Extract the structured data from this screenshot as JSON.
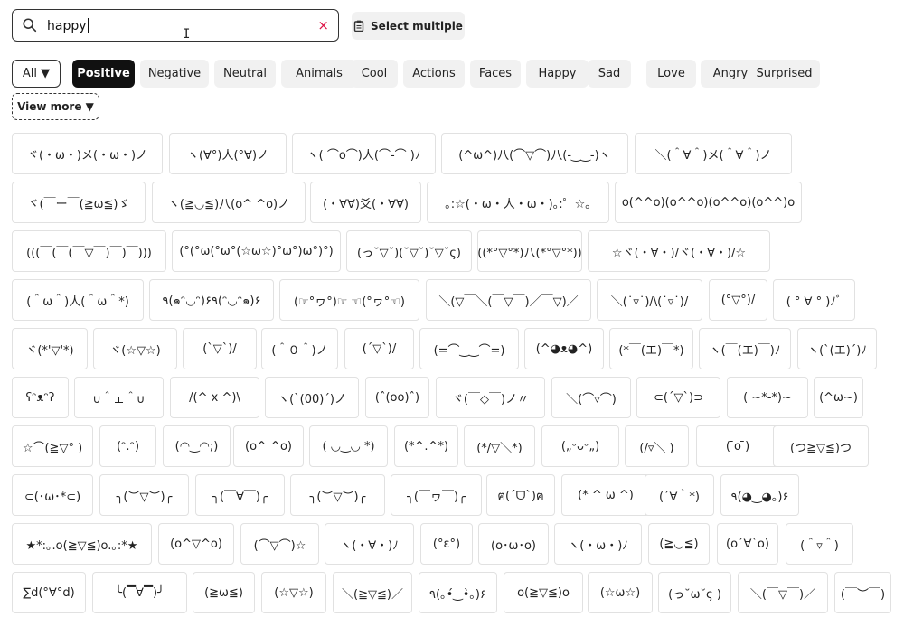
{
  "search": {
    "value": "happy",
    "clear": "×"
  },
  "toolbar": {
    "select_multiple": "Select multiple"
  },
  "filters": [
    {
      "label": "All ▼",
      "kind": "all"
    },
    {
      "label": "Positive",
      "kind": "active"
    },
    {
      "label": "Negative",
      "kind": ""
    },
    {
      "label": "Neutral",
      "kind": ""
    },
    {
      "label": "Animals",
      "kind": ""
    },
    {
      "label": "Cool",
      "kind": ""
    },
    {
      "label": "Actions",
      "kind": ""
    },
    {
      "label": "Faces",
      "kind": ""
    },
    {
      "label": "Happy",
      "kind": ""
    },
    {
      "label": "Sad",
      "kind": ""
    },
    {
      "label": "Love",
      "kind": ""
    },
    {
      "label": "Angry",
      "kind": ""
    },
    {
      "label": "Surprised",
      "kind": ""
    }
  ],
  "view_more": "View more ▼",
  "kaomoji_rows": [
    [
      "ヾ(・ω・)メ(・ω・)ノ",
      "ヽ(∀°)人(°∀)ノ",
      "ヽ( ⌒o⌒)人(⌒-⌒ )ﾉ",
      "(^ω^)八(⌒▽⌒)八(-‿‿-)ヽ",
      "＼(＾∀＾)メ(＾∀＾)ノ"
    ],
    [
      "ヾ(￣ー￣(≧ω≦)ゞ",
      "ヽ(≧◡≦)八(o^ ^o)ノ",
      "(・∀∀)爻(・∀∀)",
      "｡:☆(・ω・人・ω・)｡:゜☆｡",
      "o(^^o)(o^^o)(o^^o)(o^^)o"
    ],
    [
      "(((￣(￣(￣▽￣)￣)￣)))",
      "(°(°ω(°ω°(☆ω☆)°ω°)ω°)°)",
      "(っ˘▽˘)(˘▽˘)˘▽˘ς)",
      "(((*°▽°*)八(*°▽°*)))",
      "☆ヾ(・∀・)/ヾ(・∀・)/☆"
    ],
    [
      "(＾ω＾)人(＾ω＾*)",
      "٩(๑ᵔ◡ᵔ)۶٩(ᵔ◡ᵔ๑)۶",
      "(☞°ヮ°)☞ ☜(°ヮ°☜)",
      "＼(▽￣＼(￣▽￣)／￣▽)／",
      "＼(˙▿˙)/\\(˙▿˙)/",
      "(°▽°)/",
      "( ° ∀ ° )ﾉﾞ"
    ],
    [
      "ヾ(*'▽'*)",
      "ヾ(☆▽☆)",
      "(ˋ▽ˋ)/",
      "(＾０＾)ノ",
      "(´▽`)/",
      "(=⌒‿‿⌒=)",
      "(^◕ᴥ◕^)",
      "(*￣(エ)￣*)",
      "ヽ(￣(エ)￣)ﾉ",
      "ヽ(ˋ(エ)ˊ)ﾉ"
    ],
    [
      "ʕᵔᴥᵔʔ",
      "∪＾ェ＾∪",
      "/(^ x ^)\\",
      "ヽ(ˋ(00)ˊ)ノ",
      "(ˆ(oo)ˆ)",
      "ヾ(￣◇￣)ノ〃",
      "＼(⌒▿⌒)",
      "⊂(´▽`)⊃",
      "( ~*-*)~",
      "(^ω~)"
    ],
    [
      "☆⌒(≧▽° )",
      "(ᵔ.ᵔ)",
      "(◠‿◠;)",
      "(o^ ^o)",
      "( ◡‿◡ *)",
      "(*^.^*)",
      "(*/▽＼*)",
      "(„ᵕᴗᵕ„)",
      "(/▿＼ )",
      "( ̄o ̄)",
      "(つ≧▽≦)つ"
    ],
    [
      "⊂(･ω･*⊂)",
      "╮(︶▽︶)╭",
      "╮(￣∀￣)╭",
      "╮(︶▽︶)╭",
      "╮(￣ヮ￣)╭",
      "ฅ(ˊᗜˋ)ฅ",
      "(* ^ ω ^)",
      "(´∀｀*)",
      "٩(◕‿◕｡)۶"
    ],
    [
      "★*:｡.o(≧▽≦)o.｡:*★",
      "(o^▽^o)",
      "(⌒▽⌒)☆",
      "ヽ(・∀・)ﾉ",
      "(°ε°)",
      "(o･ω･o)",
      "ヽ(・ω・)ﾉ",
      "(≧◡≦)",
      "(o´∀`o)",
      "(＾▿＾)"
    ],
    [
      "∑d(°∀°d)",
      "╰(▔∀▔)╯",
      "(≧ω≦)",
      "(☆▽☆)",
      "＼(≧▽≦)／",
      "٩(｡•́‿•̀｡)۶",
      "o(≧▽≦)o",
      "(☆ω☆)",
      "(っ˘ω˘ς )",
      "＼(￣▽￣)／",
      "(￣︶￣)"
    ]
  ]
}
